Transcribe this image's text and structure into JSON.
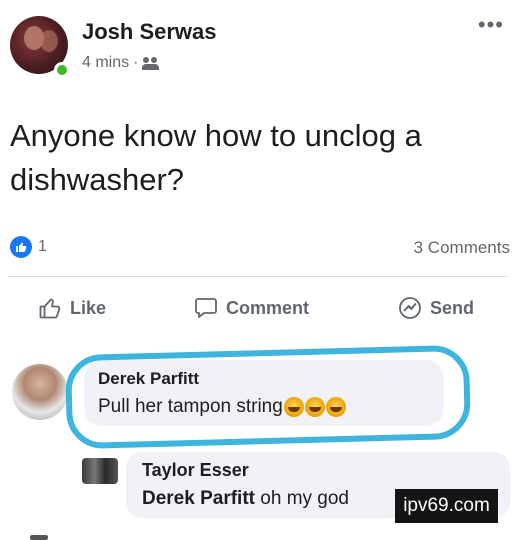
{
  "post": {
    "author": "Josh Serwas",
    "time": "4 mins",
    "separator": "·",
    "audience_icon": "friends-icon",
    "more_label": "•••",
    "text": "Anyone know how to unclog a dishwasher?"
  },
  "stats": {
    "like_count": "1",
    "comments_label": "3 Comments"
  },
  "actions": {
    "like": "Like",
    "comment": "Comment",
    "send": "Send"
  },
  "comments": [
    {
      "author": "Derek Parfitt",
      "text": "Pull her tampon string"
    }
  ],
  "replies": [
    {
      "author": "Taylor Esser",
      "tag": "Derek Parfitt",
      "text": " oh my god"
    }
  ],
  "watermark": "ipv69.com",
  "colors": {
    "brand_blue": "#1877f2",
    "online_green": "#42b72a",
    "highlight": "#3eb4de",
    "bubble_bg": "#f0f2f5"
  }
}
